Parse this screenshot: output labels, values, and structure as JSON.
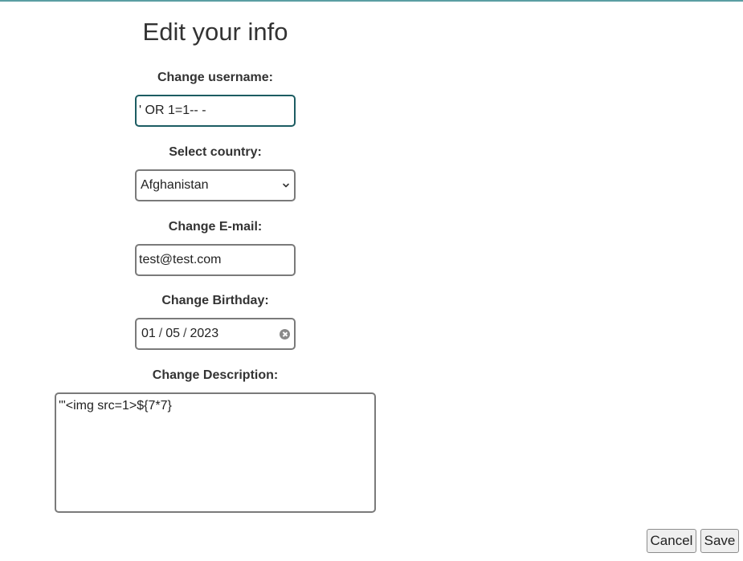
{
  "form": {
    "title": "Edit your info",
    "username": {
      "label": "Change username:",
      "value": "' OR 1=1-- -"
    },
    "country": {
      "label": "Select country:",
      "selected": "Afghanistan"
    },
    "email": {
      "label": "Change E-mail:",
      "value": "test@test.com"
    },
    "birthday": {
      "label": "Change Birthday:",
      "month": "01",
      "day": "05",
      "year": "2023",
      "separator": "/"
    },
    "description": {
      "label": "Change Description:",
      "value": "'\"<img src=1>${7*7}"
    }
  },
  "actions": {
    "cancel_label": "Cancel",
    "save_label": "Save"
  },
  "icons": {
    "select_arrow": "chevron-down-icon",
    "date_clear": "clear-icon"
  },
  "colors": {
    "accent_border": "#5a9ea3",
    "focus_border": "#1c5c62"
  }
}
